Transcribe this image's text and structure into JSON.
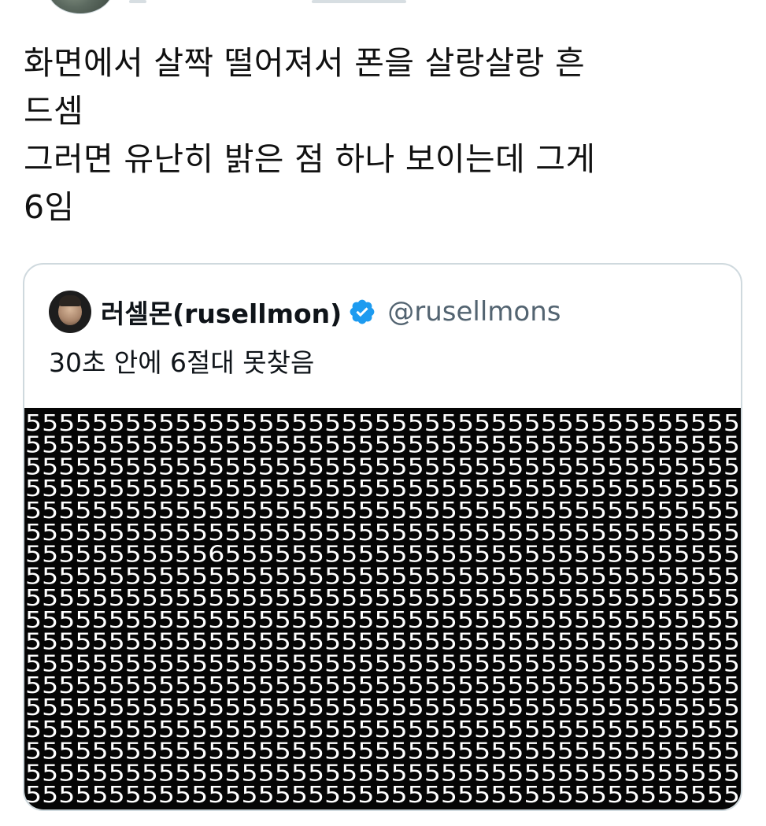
{
  "tweet": {
    "text_lines": [
      "화면에서 살짝 떨어져서 폰을 살랑살랑 흔",
      "드셈",
      "그러면 유난히 밝은 점 하나 보이는데 그게",
      "6임"
    ]
  },
  "quoted_tweet": {
    "display_name": "러셀몬(rusellmon)",
    "verified": true,
    "verified_badge_color": "#1d9bf0",
    "handle": "@rusellmons",
    "text": "30초 안에 6절대 못찾음",
    "avatar_icon": "astronaut-avatar",
    "image": {
      "description_type": "digit-grid",
      "rows": 18,
      "cols": 43,
      "background_color": "#050505",
      "digit_color": "#ffffff",
      "filler_digit": "5",
      "odd_digit": "6",
      "odd_digit_row": 6,
      "odd_digit_col": 11
    }
  },
  "colors": {
    "text_primary": "#0f1419",
    "text_secondary": "#536471",
    "card_border": "#cfd9de"
  }
}
